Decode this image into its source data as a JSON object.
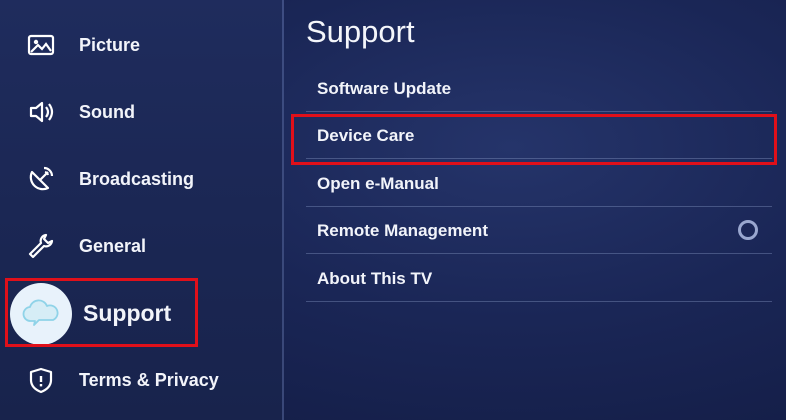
{
  "sidebar": {
    "items": [
      {
        "label": "Picture",
        "icon": "picture-icon"
      },
      {
        "label": "Sound",
        "icon": "speaker-icon"
      },
      {
        "label": "Broadcasting",
        "icon": "broadcast-icon"
      },
      {
        "label": "General",
        "icon": "wrench-icon"
      },
      {
        "label": "Support",
        "icon": "cloud-chat-icon",
        "active": true
      },
      {
        "label": "Terms & Privacy",
        "icon": "shield-icon"
      }
    ]
  },
  "content": {
    "title": "Support",
    "items": [
      {
        "label": "Software Update"
      },
      {
        "label": "Device Care"
      },
      {
        "label": "Open e-Manual"
      },
      {
        "label": "Remote Management",
        "toggle": "off"
      },
      {
        "label": "About This TV"
      }
    ]
  },
  "colors": {
    "highlight": "#e0101a",
    "background": "#1a2656",
    "active_bubble": "#e8f2fb"
  }
}
